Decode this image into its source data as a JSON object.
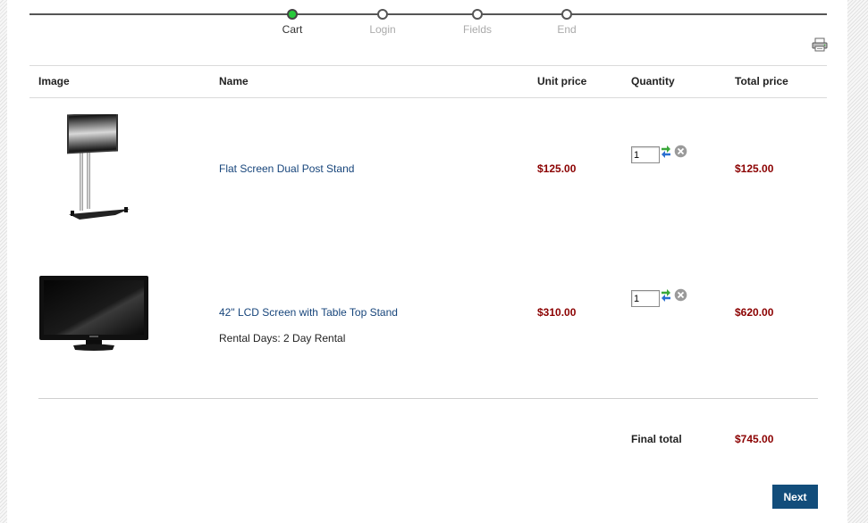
{
  "steps": [
    {
      "label": "Cart",
      "active": true
    },
    {
      "label": "Login",
      "active": false
    },
    {
      "label": "Fields",
      "active": false
    },
    {
      "label": "End",
      "active": false
    }
  ],
  "table": {
    "headers": {
      "image": "Image",
      "name": "Name",
      "unit_price": "Unit price",
      "quantity": "Quantity",
      "total_price": "Total price"
    }
  },
  "items": [
    {
      "name": "Flat Screen Dual Post Stand",
      "unit_price": "$125.00",
      "quantity": "1",
      "total_price": "$125.00",
      "meta": ""
    },
    {
      "name": "42\" LCD Screen with Table Top Stand",
      "unit_price": "$310.00",
      "quantity": "1",
      "total_price": "$620.00",
      "meta": "Rental Days: 2 Day Rental"
    }
  ],
  "summary": {
    "final_total_label": "Final total",
    "final_total_value": "$745.00"
  },
  "actions": {
    "next_label": "Next"
  },
  "icons": {
    "print": "printer-icon",
    "update": "refresh-arrows-icon",
    "remove": "remove-circle-icon"
  },
  "colors": {
    "price": "#8b0000",
    "link": "#17457b",
    "button": "#124d7b",
    "active_step": "#27c93a"
  }
}
